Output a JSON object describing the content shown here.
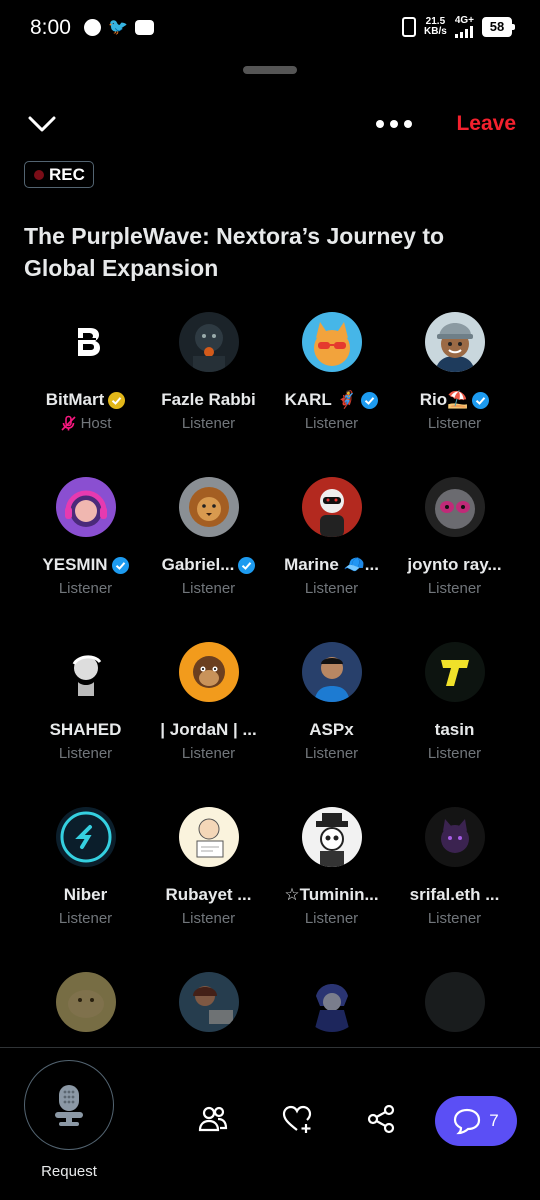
{
  "status_bar": {
    "time": "8:00",
    "net_speed_value": "21.5",
    "net_speed_unit": "KB/s",
    "net_type": "4G+",
    "battery": "58"
  },
  "header": {
    "leave_label": "Leave",
    "rec_label": "REC"
  },
  "space": {
    "title": "The PurpleWave: Nextora’s Journey to Global Expansion"
  },
  "participants": [
    {
      "name": "BitMart",
      "role": "Host",
      "verified": "gold",
      "muted": true,
      "avatar": "bitmart-logo"
    },
    {
      "name": "Fazle Rabbi",
      "role": "Listener",
      "verified": "",
      "avatar": "dark-robot"
    },
    {
      "name": "KARL 🦸",
      "role": "Listener",
      "verified": "blue",
      "avatar": "cat-sunglasses"
    },
    {
      "name": "Rio⛱️",
      "role": "Listener",
      "verified": "blue",
      "avatar": "cartoon-man"
    },
    {
      "name": "YESMIN",
      "role": "Listener",
      "verified": "blue",
      "avatar": "girl-headphones"
    },
    {
      "name": "Gabriel...",
      "role": "Listener",
      "verified": "blue",
      "avatar": "lion"
    },
    {
      "name": "Marine 🧢...",
      "role": "Listener",
      "verified": "",
      "avatar": "red-robot"
    },
    {
      "name": "joynto ray...",
      "role": "Listener",
      "verified": "",
      "avatar": "cat-space"
    },
    {
      "name": "SHAHED",
      "role": "Listener",
      "verified": "",
      "avatar": "sketch-face"
    },
    {
      "name": "| JordaN | ...",
      "role": "Listener",
      "verified": "",
      "avatar": "ape"
    },
    {
      "name": "ASPx",
      "role": "Listener",
      "verified": "",
      "avatar": "man-photo"
    },
    {
      "name": "tasin",
      "role": "Listener",
      "verified": "",
      "avatar": "t-logo"
    },
    {
      "name": "Niber",
      "role": "Listener",
      "verified": "",
      "avatar": "sui-logo"
    },
    {
      "name": "Rubayet ...",
      "role": "Listener",
      "verified": "",
      "avatar": "cartoon-sign"
    },
    {
      "name": "☆Tuminin...",
      "role": "Listener",
      "verified": "",
      "avatar": "skeleton-hat"
    },
    {
      "name": "srifal.eth ...",
      "role": "Listener",
      "verified": "",
      "avatar": "purple-cat"
    },
    {
      "name": "",
      "role": "",
      "verified": "",
      "avatar": "doge"
    },
    {
      "name": "",
      "role": "",
      "verified": "",
      "avatar": "girl-laptop"
    },
    {
      "name": "",
      "role": "",
      "verified": "",
      "avatar": "anime-hood"
    },
    {
      "name": "",
      "role": "",
      "verified": "",
      "avatar": "empty"
    }
  ],
  "bottom_bar": {
    "request_label": "Request",
    "comments_count": "7"
  },
  "colors": {
    "accent": "#5b4ff5",
    "leave": "#f4212e",
    "verified_blue": "#1d9bf0",
    "verified_gold": "#e2b719",
    "muted_text": "#71767b"
  }
}
